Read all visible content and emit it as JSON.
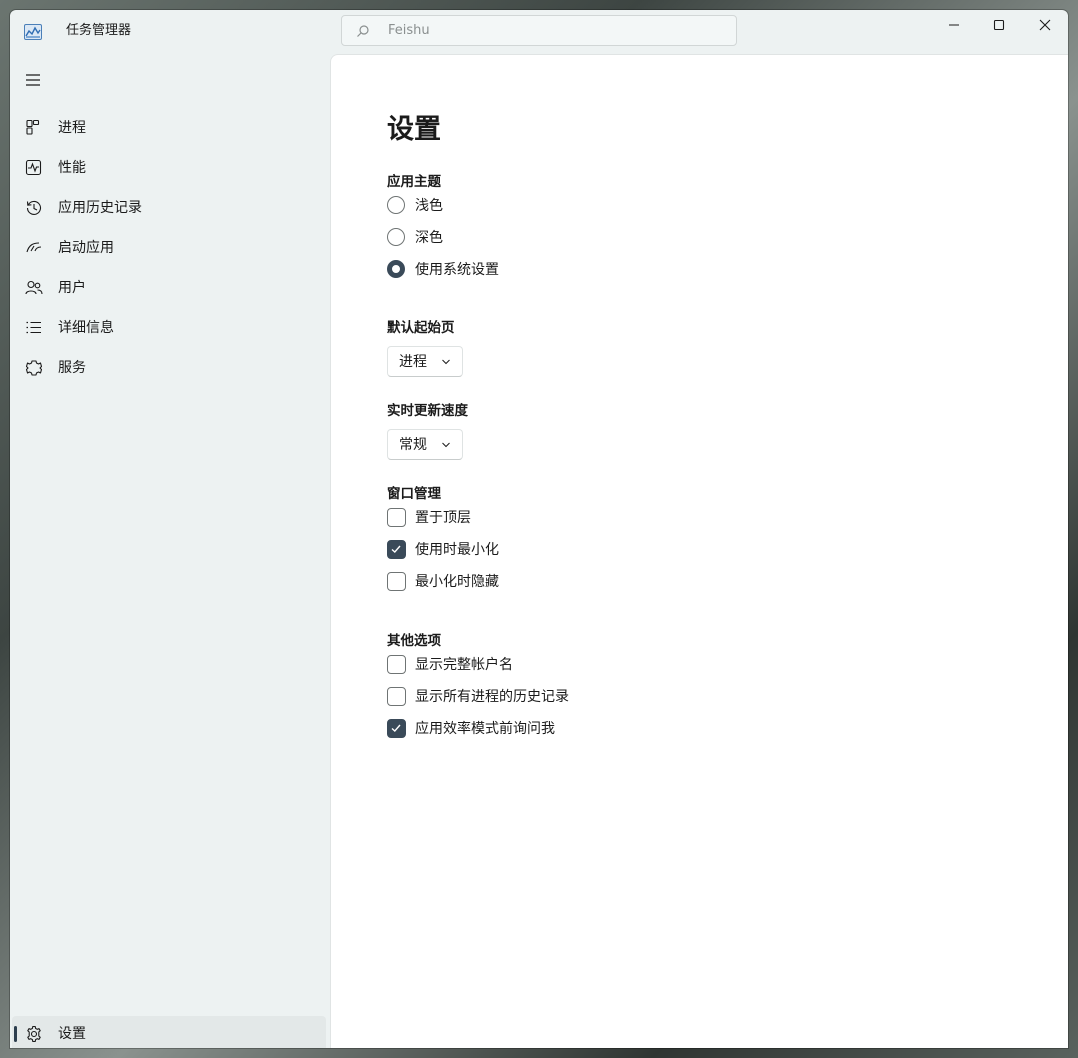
{
  "window": {
    "title": "任务管理器",
    "search_placeholder": "Feishu"
  },
  "sidebar": {
    "items": [
      {
        "label": "进程",
        "icon": "processes-icon"
      },
      {
        "label": "性能",
        "icon": "performance-icon"
      },
      {
        "label": "应用历史记录",
        "icon": "history-icon"
      },
      {
        "label": "启动应用",
        "icon": "startup-icon"
      },
      {
        "label": "用户",
        "icon": "users-icon"
      },
      {
        "label": "详细信息",
        "icon": "details-icon"
      },
      {
        "label": "服务",
        "icon": "services-icon"
      }
    ],
    "settings_label": "设置"
  },
  "settings": {
    "title": "设置",
    "theme": {
      "heading": "应用主题",
      "options": [
        "浅色",
        "深色",
        "使用系统设置"
      ],
      "selected": "使用系统设置"
    },
    "start_page": {
      "heading": "默认起始页",
      "value": "进程"
    },
    "update_speed": {
      "heading": "实时更新速度",
      "value": "常规"
    },
    "window_mgmt": {
      "heading": "窗口管理",
      "options": [
        {
          "label": "置于顶层",
          "checked": false
        },
        {
          "label": "使用时最小化",
          "checked": true
        },
        {
          "label": "最小化时隐藏",
          "checked": false
        }
      ]
    },
    "other": {
      "heading": "其他选项",
      "options": [
        {
          "label": "显示完整帐户名",
          "checked": false
        },
        {
          "label": "显示所有进程的历史记录",
          "checked": false
        },
        {
          "label": "应用效率模式前询问我",
          "checked": true
        }
      ]
    }
  },
  "colors": {
    "accent": "#3a4a59",
    "sidebar_bg": "#edf2f2",
    "content_bg": "#ffffff"
  }
}
